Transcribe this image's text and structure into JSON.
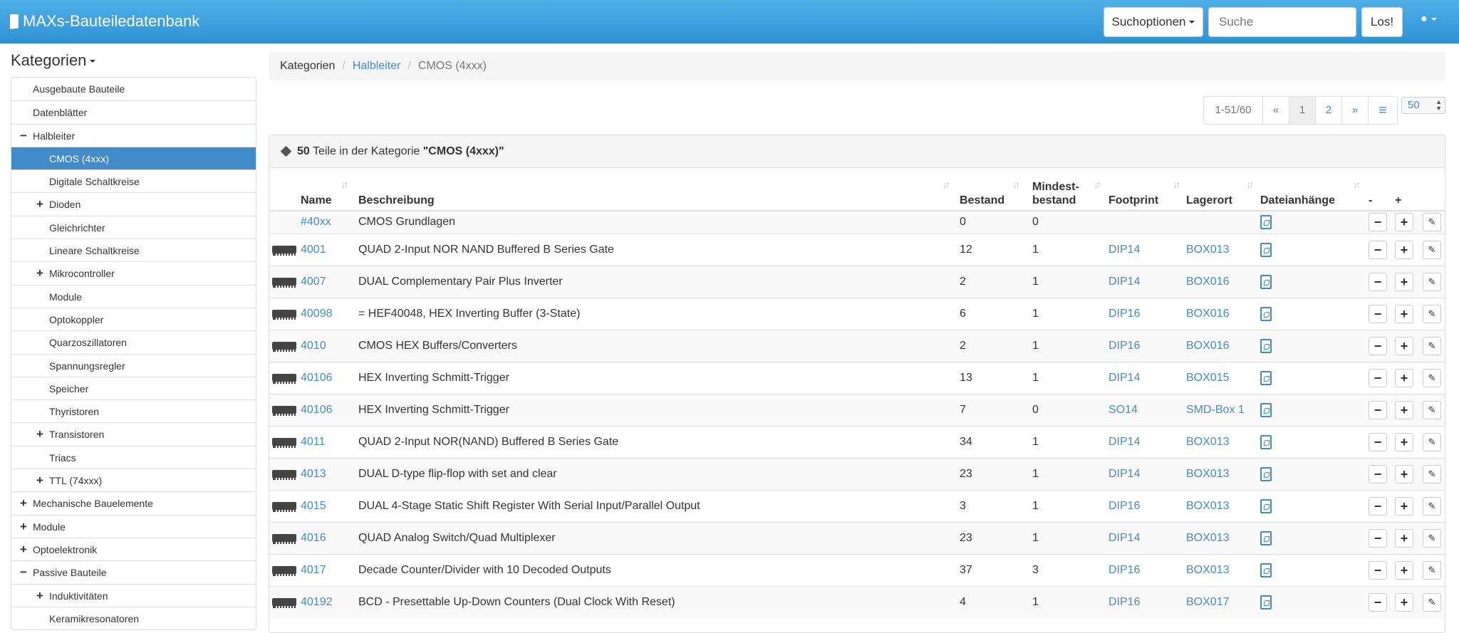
{
  "app": {
    "title": "MAXs-Bauteiledatenbank"
  },
  "navbar": {
    "search_options": "Suchoptionen",
    "search_placeholder": "Suche",
    "go_label": "Los!",
    "user_icon": "user-icon"
  },
  "sidebar": {
    "title": "Kategorien",
    "items": [
      {
        "label": "Ausgebaute Bauteile",
        "toggle": "",
        "indent": 1
      },
      {
        "label": "Datenblätter",
        "toggle": "",
        "indent": 1
      },
      {
        "label": "Halbleiter",
        "toggle": "−",
        "indent": 1
      },
      {
        "label": "CMOS (4xxx)",
        "toggle": "",
        "indent": 2,
        "active": true
      },
      {
        "label": "Digitale Schaltkreise",
        "toggle": "",
        "indent": 2
      },
      {
        "label": "Dioden",
        "toggle": "+",
        "indent": 2
      },
      {
        "label": "Gleichrichter",
        "toggle": "",
        "indent": 2
      },
      {
        "label": "Lineare Schaltkreise",
        "toggle": "",
        "indent": 2
      },
      {
        "label": "Mikrocontroller",
        "toggle": "+",
        "indent": 2
      },
      {
        "label": "Module",
        "toggle": "",
        "indent": 2
      },
      {
        "label": "Optokoppler",
        "toggle": "",
        "indent": 2
      },
      {
        "label": "Quarzoszillatoren",
        "toggle": "",
        "indent": 2
      },
      {
        "label": "Spannungsregler",
        "toggle": "",
        "indent": 2
      },
      {
        "label": "Speicher",
        "toggle": "",
        "indent": 2
      },
      {
        "label": "Thyristoren",
        "toggle": "",
        "indent": 2
      },
      {
        "label": "Transistoren",
        "toggle": "+",
        "indent": 2
      },
      {
        "label": "Triacs",
        "toggle": "",
        "indent": 2
      },
      {
        "label": "TTL (74xxx)",
        "toggle": "+",
        "indent": 2
      },
      {
        "label": "Mechanische Bauelemente",
        "toggle": "+",
        "indent": 1
      },
      {
        "label": "Module",
        "toggle": "+",
        "indent": 1
      },
      {
        "label": "Optoelektronik",
        "toggle": "+",
        "indent": 1
      },
      {
        "label": "Passive Bauteile",
        "toggle": "−",
        "indent": 1
      },
      {
        "label": "Induktivitäten",
        "toggle": "+",
        "indent": 2
      },
      {
        "label": "Keramikresonatoren",
        "toggle": "",
        "indent": 2
      }
    ]
  },
  "breadcrumb": [
    "Kategorien",
    "Halbleiter",
    "CMOS (4xxx)"
  ],
  "pagination": {
    "info": "1-51/60",
    "first": "«",
    "pages": [
      "1",
      "2"
    ],
    "next": "»",
    "list_icon": "≡",
    "per_page": "50"
  },
  "panel": {
    "count": "50",
    "text": " Teile in der Kategorie ",
    "category": "\"CMOS (4xxx)\""
  },
  "table": {
    "headers": {
      "name": "Name",
      "desc": "Beschreibung",
      "stock": "Bestand",
      "minstock_1": "Mindest-",
      "minstock_2": "bestand",
      "footprint": "Footprint",
      "storage": "Lagerort",
      "attachments": "Dateianhänge",
      "minus": "-",
      "plus": "+"
    },
    "rows": [
      {
        "name": "#40xx",
        "desc": "CMOS Grundlagen",
        "stock": "0",
        "min": "0",
        "footprint": "",
        "storage": "",
        "chip": false
      },
      {
        "name": "4001",
        "desc": "QUAD 2-Input NOR NAND Buffered B Series Gate",
        "stock": "12",
        "min": "1",
        "footprint": "DIP14",
        "storage": "BOX013",
        "chip": true
      },
      {
        "name": "4007",
        "desc": "DUAL Complementary Pair Plus Inverter",
        "stock": "2",
        "min": "1",
        "footprint": "DIP14",
        "storage": "BOX016",
        "chip": true
      },
      {
        "name": "40098",
        "desc": "= HEF40048, HEX Inverting Buffer (3-State)",
        "stock": "6",
        "min": "1",
        "footprint": "DIP16",
        "storage": "BOX016",
        "chip": true
      },
      {
        "name": "4010",
        "desc": "CMOS HEX Buffers/Converters",
        "stock": "2",
        "min": "1",
        "footprint": "DIP16",
        "storage": "BOX016",
        "chip": true
      },
      {
        "name": "40106",
        "desc": "HEX Inverting Schmitt-Trigger",
        "stock": "13",
        "min": "1",
        "footprint": "DIP14",
        "storage": "BOX015",
        "chip": true
      },
      {
        "name": "40106",
        "desc": "HEX Inverting Schmitt-Trigger",
        "stock": "7",
        "min": "0",
        "footprint": "SO14",
        "storage": "SMD-Box 1",
        "chip": true
      },
      {
        "name": "4011",
        "desc": "QUAD 2-Input NOR(NAND) Buffered B Series Gate",
        "stock": "34",
        "min": "1",
        "footprint": "DIP14",
        "storage": "BOX013",
        "chip": true
      },
      {
        "name": "4013",
        "desc": "DUAL D-type flip-flop with set and clear",
        "stock": "23",
        "min": "1",
        "footprint": "DIP14",
        "storage": "BOX013",
        "chip": true
      },
      {
        "name": "4015",
        "desc": "DUAL 4-Stage Static Shift Register With Serial Input/Parallel Output",
        "stock": "3",
        "min": "1",
        "footprint": "DIP16",
        "storage": "BOX013",
        "chip": true
      },
      {
        "name": "4016",
        "desc": "QUAD Analog Switch/Quad Multiplexer",
        "stock": "23",
        "min": "1",
        "footprint": "DIP14",
        "storage": "BOX013",
        "chip": true
      },
      {
        "name": "4017",
        "desc": "Decade Counter/Divider with 10 Decoded Outputs",
        "stock": "37",
        "min": "3",
        "footprint": "DIP16",
        "storage": "BOX013",
        "chip": true
      },
      {
        "name": "40192",
        "desc": "BCD - Presettable Up-Down Counters (Dual Clock With Reset)",
        "stock": "4",
        "min": "1",
        "footprint": "DIP16",
        "storage": "BOX017",
        "chip": true
      }
    ]
  }
}
